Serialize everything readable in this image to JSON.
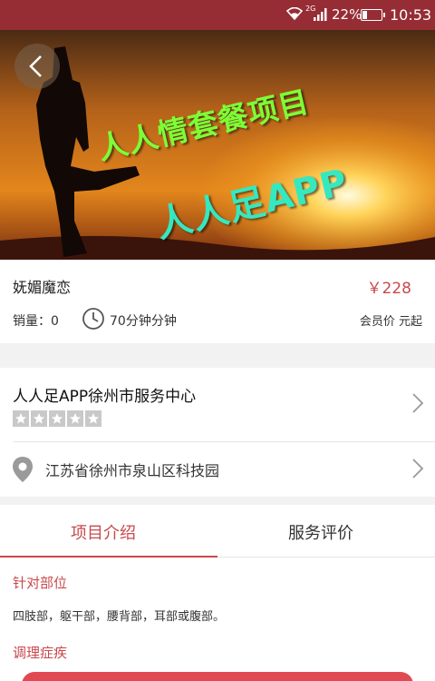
{
  "status_bar": {
    "network_label": "2G",
    "battery_percent": "22%",
    "time": "10:53"
  },
  "hero": {
    "line1": "人人情套餐项目",
    "line2": "人人足APP"
  },
  "product": {
    "name": "妩媚魔恋",
    "price": "￥228",
    "sales": "销量：0",
    "duration": "70分钟分钟",
    "member_price": "会员价  元起"
  },
  "shop": {
    "name": "人人足APP徐州市服务中心",
    "rating_stars": 5,
    "address": "江苏省徐州市泉山区科技园"
  },
  "tabs": [
    {
      "label": "项目介绍"
    },
    {
      "label": "服务评价"
    }
  ],
  "sections": [
    {
      "title": "针对部位",
      "body": "四肢部，躯干部，腰背部，耳部或腹部。"
    },
    {
      "title": "调理症疾"
    }
  ],
  "colors": {
    "status_bar": "#962d35",
    "accent": "#c8494d",
    "button": "#e04a52"
  }
}
